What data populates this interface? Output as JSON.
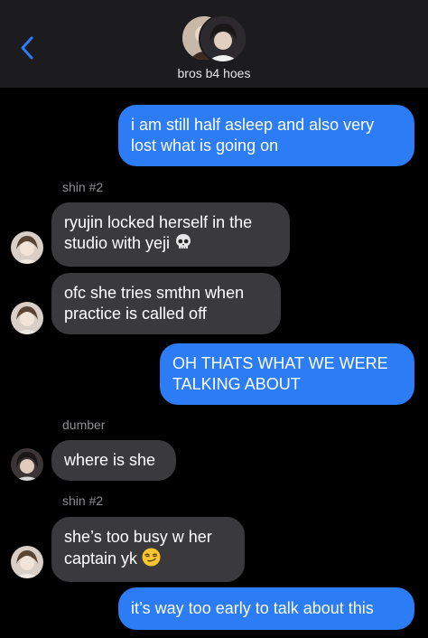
{
  "header": {
    "group_name": "bros b4 hoes",
    "back_icon": "chevron-left-icon"
  },
  "colors": {
    "outgoing_bubble": "#2b7cf5",
    "incoming_bubble": "#3a3a3c",
    "header_bg": "#1c1c1e",
    "accent": "#2b7cf5"
  },
  "messages": [
    {
      "from": "me",
      "text": "i am still half asleep and also very lost what is going on"
    },
    {
      "sender_label": "shin #2"
    },
    {
      "from": "shin #2",
      "text": "ryujin locked herself in the studio with yeji",
      "emoji": "skull-emoji"
    },
    {
      "from": "shin #2",
      "text": "ofc she tries smthn when practice is called off"
    },
    {
      "from": "me",
      "text": "OH THATS WHAT WE WERE TALKING ABOUT"
    },
    {
      "sender_label": "dumber"
    },
    {
      "from": "dumber",
      "text": "where is she"
    },
    {
      "sender_label": "shin #2"
    },
    {
      "from": "shin #2",
      "text": "she’s too busy w her captain yk",
      "emoji": "smirk-emoji"
    },
    {
      "from": "me",
      "text": "it’s way too early to talk about this"
    }
  ]
}
